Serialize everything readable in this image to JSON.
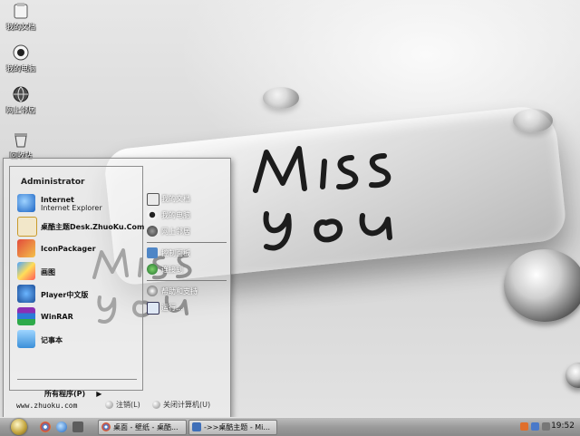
{
  "desktop": {
    "icons": [
      {
        "label": "我的文档",
        "icon": "my-documents-icon"
      },
      {
        "label": "我的电脑",
        "icon": "my-computer-icon"
      },
      {
        "label": "网上邻居",
        "icon": "network-places-icon"
      },
      {
        "label": "回收站",
        "icon": "recycle-bin-icon"
      }
    ],
    "wallpaper_text": "Miss You"
  },
  "start_menu": {
    "user": "Administrator",
    "pinned": [
      {
        "title": "Internet",
        "subtitle": "Internet Explorer",
        "icon": "internet-explorer-icon"
      },
      {
        "title": "桌酷主题Desk.ZhuoKu.Com",
        "subtitle": "",
        "icon": "zhuoku-theme-icon"
      },
      {
        "title": "IconPackager",
        "subtitle": "",
        "icon": "iconpackager-icon"
      },
      {
        "title": "画图",
        "subtitle": "",
        "icon": "paint-icon"
      },
      {
        "title": "Player中文版",
        "subtitle": "",
        "icon": "media-player-icon"
      },
      {
        "title": "WinRAR",
        "subtitle": "",
        "icon": "winrar-icon"
      },
      {
        "title": "记事本",
        "subtitle": "",
        "icon": "notepad-icon"
      }
    ],
    "all_programs": "所有程序(P)",
    "places": [
      {
        "label": "我的文档",
        "icon": "my-documents-icon"
      },
      {
        "label": "我的电脑",
        "icon": "my-computer-icon"
      },
      {
        "label": "网上邻居",
        "icon": "network-places-icon"
      },
      {
        "label": "控制面板",
        "icon": "control-panel-icon"
      },
      {
        "label": "连接到",
        "icon": "connect-to-icon"
      },
      {
        "label": "帮助和支持",
        "icon": "help-icon"
      },
      {
        "label": "运行...",
        "icon": "run-icon"
      }
    ],
    "footer_url": "www.zhuoku.com",
    "logoff": "注销(L)",
    "shutdown": "关闭计算机(U)"
  },
  "taskbar": {
    "quick_launch": [
      "chrome-icon",
      "ie-icon",
      "show-desktop-icon"
    ],
    "tasks": [
      {
        "label": "桌面 - 壁纸 - 桌酷...",
        "icon": "chrome-icon"
      },
      {
        "label": "->>桌酷主题 - Mi...",
        "icon": "window-icon"
      }
    ],
    "tray_icons": [
      "ime-icon",
      "network-icon",
      "volume-icon"
    ],
    "clock": "19:52"
  }
}
